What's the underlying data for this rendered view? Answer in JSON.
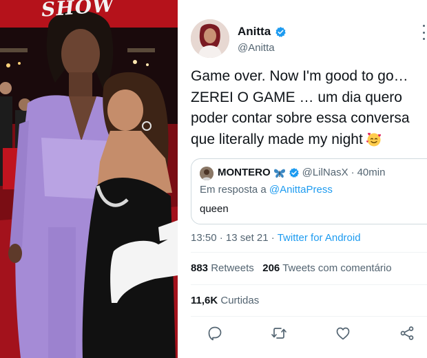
{
  "photo": {
    "sign_text": "SHOW"
  },
  "tweet": {
    "author": {
      "display_name": "Anitta",
      "handle": "@Anitta",
      "verified": true
    },
    "text": "Game over. Now I'm good to go…\nZEREI O GAME … um dia quero\npoder contar sobre essa conversa\nque literally made my night",
    "text_emoji": "smiling-face-with-hearts-emoji",
    "quote": {
      "display_name": "MONTERO",
      "name_emoji": "butterfly-emoji",
      "verified": true,
      "handle": "@LilNasX",
      "separator": "·",
      "time": "40min",
      "reply_prefix": "Em resposta a",
      "reply_to": "@AnittaPress",
      "text": "queen"
    },
    "meta": {
      "time": "13:50",
      "sep1": "·",
      "date": "13 set 21",
      "sep2": "·",
      "source": "Twitter for Android"
    },
    "stats": {
      "retweets_count": "883",
      "retweets_label": "Retweets",
      "quotes_count": "206",
      "quotes_label": "Tweets com comentário",
      "likes_count": "11,6K",
      "likes_label": "Curtidas"
    },
    "actions": [
      "reply-icon",
      "retweet-icon",
      "like-icon",
      "share-icon"
    ]
  },
  "colors": {
    "link": "#1d9bf0",
    "secondary_text": "#536471",
    "border": "#cfd9de"
  }
}
